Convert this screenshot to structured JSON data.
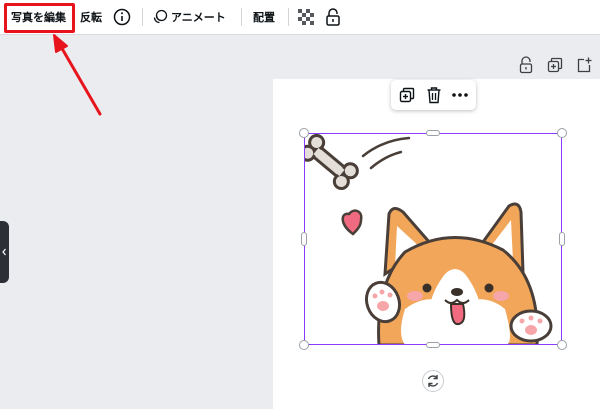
{
  "toolbar": {
    "edit_photo_label": "写真を編集",
    "flip_label": "反転",
    "animate_label": "アニメート",
    "position_label": "配置"
  },
  "icons": {
    "info": "info-icon",
    "animate": "animate-icon",
    "transparency": "transparency-icon",
    "lock": "lock-icon",
    "duplicate": "duplicate-icon",
    "trash": "trash-icon",
    "more": "more-icon",
    "add_page": "add-page-icon",
    "rotate": "rotate-icon",
    "collapse": "chevron-left-icon"
  },
  "colors": {
    "highlight": "#e8141c",
    "selection": "#8b3dff",
    "corgi_orange": "#f2a65a",
    "heart_pink": "#f06b80"
  }
}
